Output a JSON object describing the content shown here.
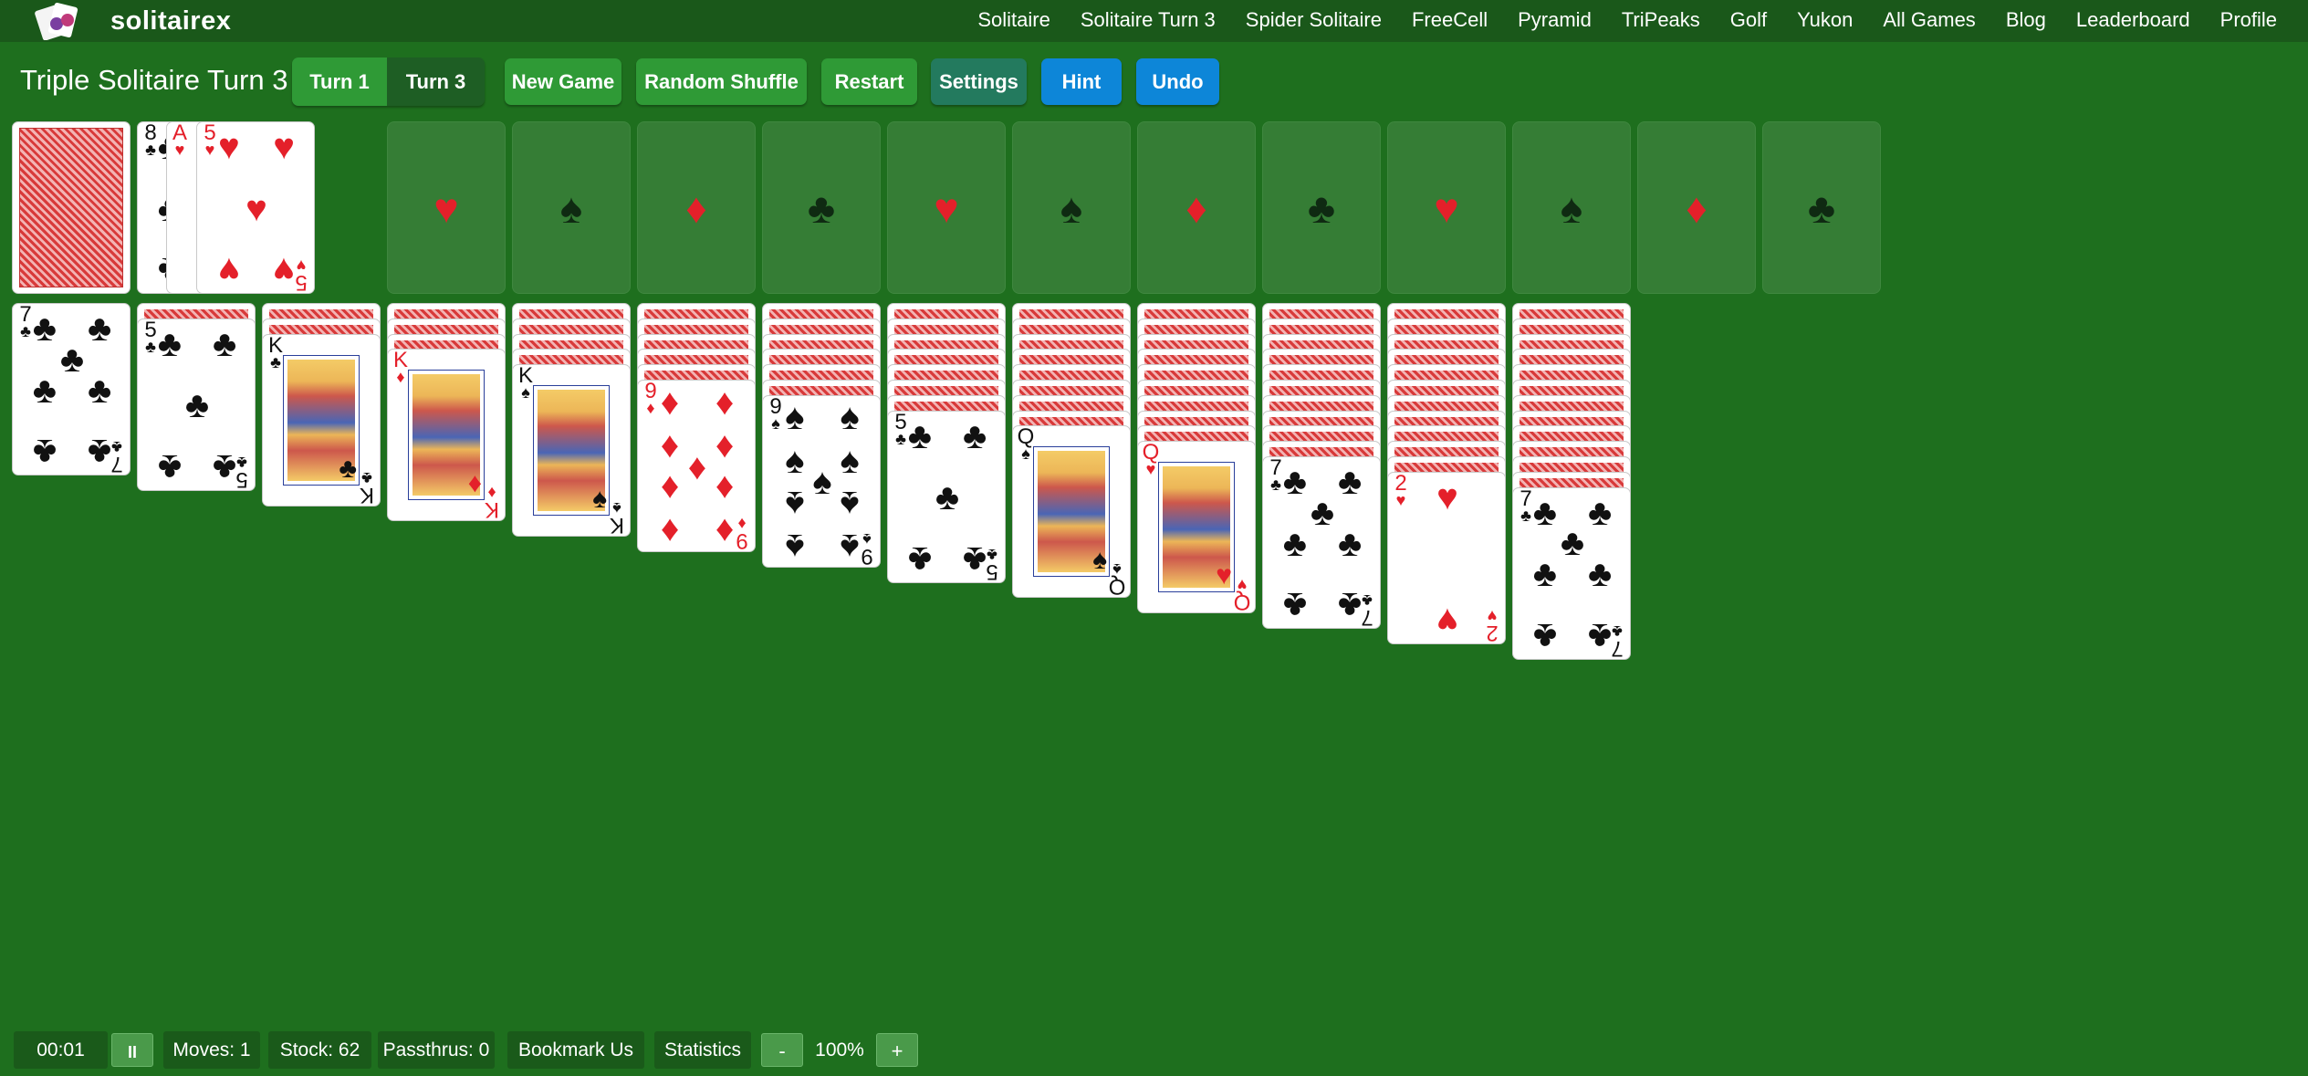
{
  "brand": {
    "name": "solitairex"
  },
  "nav": [
    "Solitaire",
    "Solitaire Turn 3",
    "Spider Solitaire",
    "FreeCell",
    "Pyramid",
    "TriPeaks",
    "Golf",
    "Yukon",
    "All Games",
    "Blog",
    "Leaderboard",
    "Profile"
  ],
  "toolbar": {
    "title": "Triple Solitaire Turn 3",
    "turn1": "Turn 1",
    "turn3": "Turn 3",
    "new_game": "New Game",
    "random_shuffle": "Random Shuffle",
    "restart": "Restart",
    "settings": "Settings",
    "hint": "Hint",
    "undo": "Undo"
  },
  "waste": [
    {
      "rank": "8",
      "suit": "♣"
    },
    {
      "rank": "A",
      "suit": "♥"
    },
    {
      "rank": "5",
      "suit": "♥"
    }
  ],
  "foundations": [
    "♥",
    "♠",
    "♦",
    "♣",
    "♥",
    "♠",
    "♦",
    "♣",
    "♥",
    "♠",
    "♦",
    "♣"
  ],
  "tableau": [
    {
      "hidden": 0,
      "rank": "7",
      "suit": "♣"
    },
    {
      "hidden": 1,
      "rank": "5",
      "suit": "♣"
    },
    {
      "hidden": 2,
      "rank": "K",
      "suit": "♣"
    },
    {
      "hidden": 3,
      "rank": "K",
      "suit": "♦"
    },
    {
      "hidden": 4,
      "rank": "K",
      "suit": "♠"
    },
    {
      "hidden": 5,
      "rank": "9",
      "suit": "♦"
    },
    {
      "hidden": 6,
      "rank": "9",
      "suit": "♠"
    },
    {
      "hidden": 7,
      "rank": "5",
      "suit": "♣"
    },
    {
      "hidden": 8,
      "rank": "Q",
      "suit": "♠"
    },
    {
      "hidden": 9,
      "rank": "Q",
      "suit": "♥"
    },
    {
      "hidden": 10,
      "rank": "7",
      "suit": "♣"
    },
    {
      "hidden": 11,
      "rank": "2",
      "suit": "♥"
    },
    {
      "hidden": 12,
      "rank": "7",
      "suit": "♣"
    }
  ],
  "status": {
    "timer": "00:01",
    "pause_icon": "pause-icon",
    "pause_label": "II",
    "moves": "Moves: 1",
    "stock": "Stock: 62",
    "passthrus": "Passthrus: 0",
    "bookmark": "Bookmark Us",
    "statistics": "Statistics",
    "zoom_out": "-",
    "zoom": "100%",
    "zoom_in": "+"
  },
  "colors": {
    "felt": "#1e6f1e",
    "nav": "#1a581a",
    "button_green": "#2f9a36",
    "button_blue": "#0d86d8",
    "card_red": "#e4202a"
  }
}
